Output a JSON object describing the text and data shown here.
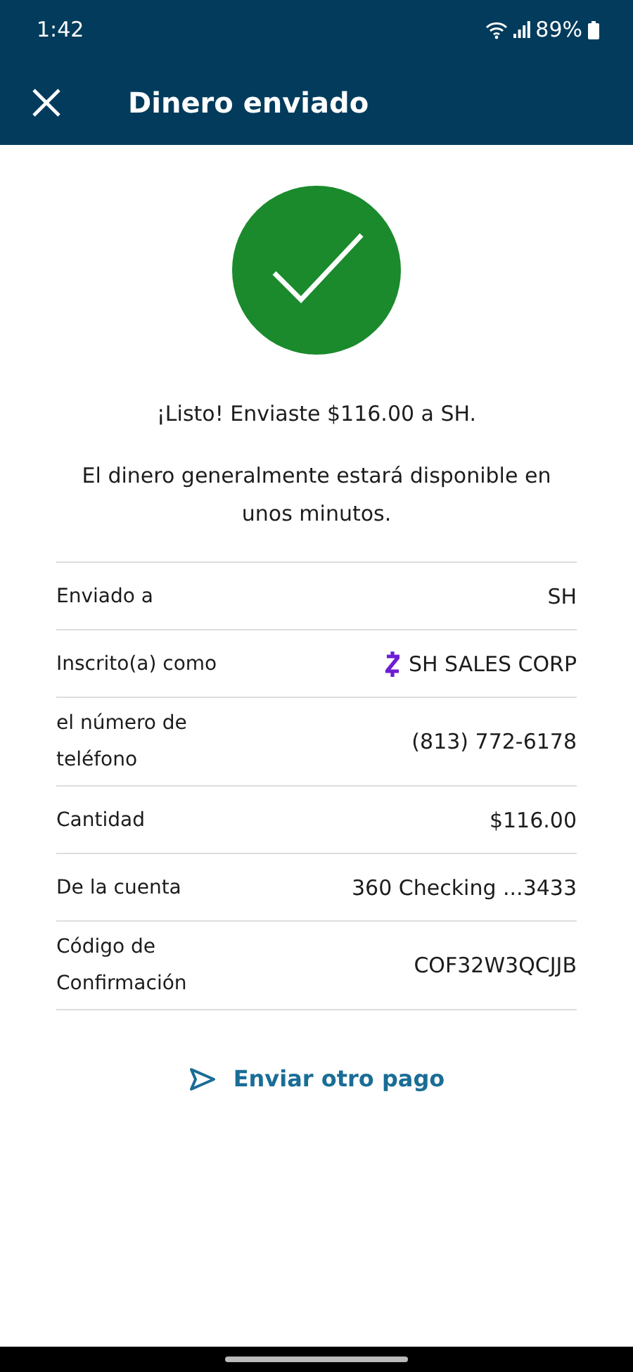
{
  "status_bar": {
    "time": "1:42",
    "battery": "89%"
  },
  "header": {
    "title": "Dinero enviado"
  },
  "message": "¡Listo! Enviaste $116.00 a SH.",
  "note": "El dinero generalmente estará disponible en unos minutos.",
  "details": [
    {
      "kind": "plain",
      "label": "Enviado a",
      "value": "SH"
    },
    {
      "kind": "zelle",
      "label": "Inscrito(a) como",
      "value": "SH SALES CORP"
    },
    {
      "kind": "plain",
      "label": "el número de teléfono",
      "value": "(813) 772-6178"
    },
    {
      "kind": "plain",
      "label": "Cantidad",
      "value": "$116.00"
    },
    {
      "kind": "plain",
      "label": "De la cuenta",
      "value": "360 Checking ...3433"
    },
    {
      "kind": "plain",
      "label": "Código de Confirmación",
      "value": "COF32W3QCJJB"
    }
  ],
  "action": "Enviar otro pago"
}
